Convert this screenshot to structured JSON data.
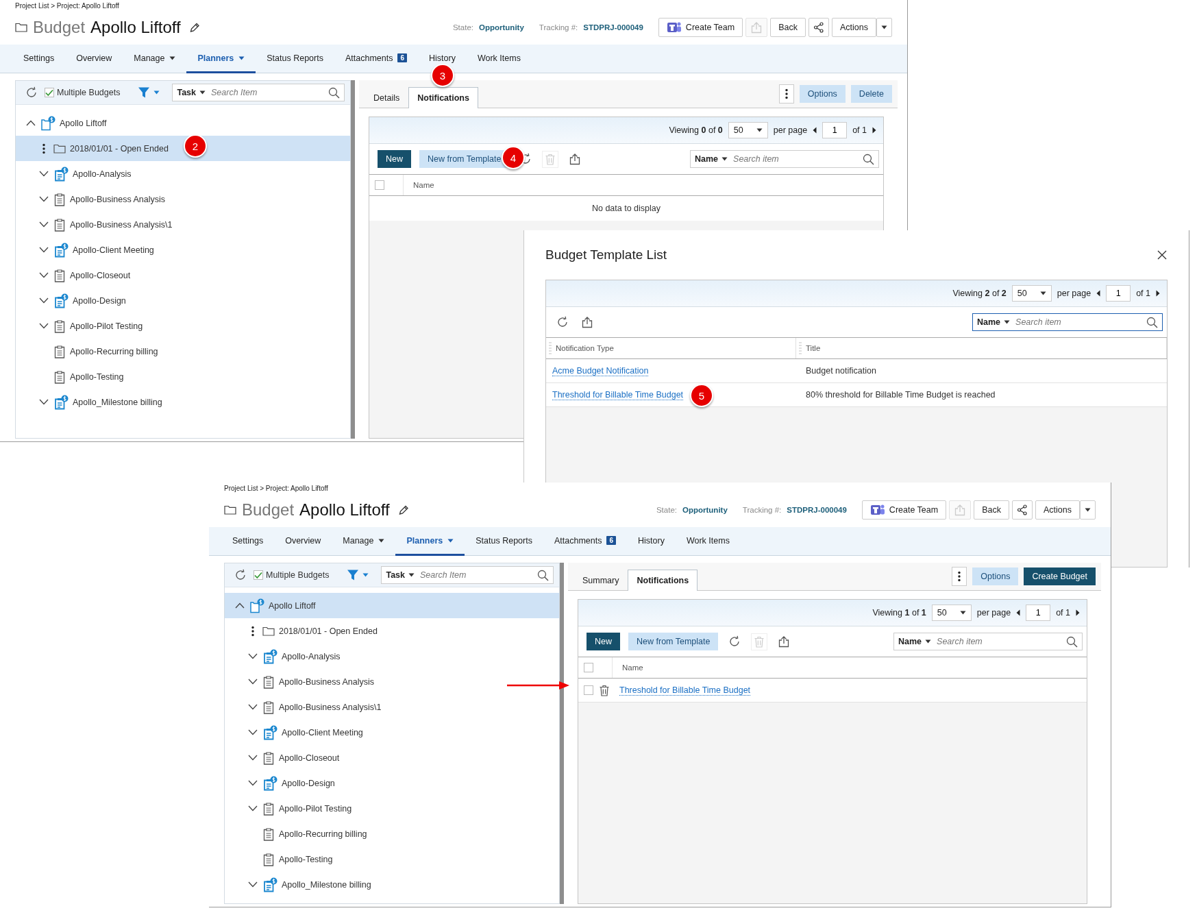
{
  "top_window": {
    "breadcrumb": "Project List > Project: Apollo Liftoff",
    "type_label": "Budget",
    "title": "Apollo Liftoff",
    "state_label": "State:",
    "state": "Opportunity",
    "tracking_label": "Tracking #:",
    "tracking": "STDPRJ-000049",
    "header_buttons": [
      {
        "kind": "teams",
        "label": "Create Team",
        "disabled": false
      },
      {
        "kind": "export",
        "disabled": true
      },
      {
        "kind": "text",
        "label": "Back",
        "disabled": false
      },
      {
        "kind": "share",
        "disabled": false
      },
      {
        "kind": "split",
        "label": "Actions",
        "disabled": false
      }
    ],
    "nav": [
      {
        "label": "Settings",
        "selected": false,
        "dropdown": false
      },
      {
        "label": "Overview",
        "selected": false,
        "dropdown": false
      },
      {
        "label": "Manage",
        "selected": false,
        "dropdown": true
      },
      {
        "label": "Planners",
        "selected": true,
        "dropdown": true
      },
      {
        "label": "Status Reports",
        "selected": false,
        "dropdown": false
      },
      {
        "label": "Attachments",
        "selected": false,
        "dropdown": false,
        "badge": "6"
      },
      {
        "label": "History",
        "selected": false,
        "dropdown": false
      },
      {
        "label": "Work Items",
        "selected": false,
        "dropdown": false
      }
    ],
    "tree_toolbar": {
      "multiple_budgets": {
        "label": "Multiple Budgets",
        "checked": true
      },
      "search": {
        "scope": "Task",
        "placeholder": "Search Item"
      }
    },
    "tree": [
      {
        "label": "Apollo Liftoff",
        "kind": "project",
        "expandable": true,
        "expanded": true,
        "menu": false,
        "selected": false,
        "children": [
          {
            "label": "2018/01/01 - Open Ended",
            "kind": "folder",
            "expandable": false,
            "menu": true,
            "selected": true
          },
          {
            "label": "Apollo-Analysis",
            "kind": "budget",
            "expandable": true,
            "expanded": false,
            "menu": false,
            "selected": false
          },
          {
            "label": "Apollo-Business Analysis",
            "kind": "task",
            "expandable": true,
            "expanded": false,
            "menu": false,
            "selected": false
          },
          {
            "label": "Apollo-Business Analysis\\1",
            "kind": "task",
            "expandable": true,
            "expanded": false,
            "menu": false,
            "selected": false
          },
          {
            "label": "Apollo-Client Meeting",
            "kind": "budget",
            "expandable": true,
            "expanded": false,
            "menu": false,
            "selected": false
          },
          {
            "label": "Apollo-Closeout",
            "kind": "task",
            "expandable": true,
            "expanded": false,
            "menu": false,
            "selected": false
          },
          {
            "label": "Apollo-Design",
            "kind": "budget",
            "expandable": true,
            "expanded": false,
            "menu": false,
            "selected": false
          },
          {
            "label": "Apollo-Pilot Testing",
            "kind": "task",
            "expandable": true,
            "expanded": false,
            "menu": false,
            "selected": false
          },
          {
            "label": "Apollo-Recurring billing",
            "kind": "task",
            "expandable": false,
            "menu": false,
            "selected": false
          },
          {
            "label": "Apollo-Testing",
            "kind": "task",
            "expandable": false,
            "menu": false,
            "selected": false
          },
          {
            "label": "Apollo_Milestone billing",
            "kind": "budget",
            "expandable": true,
            "expanded": false,
            "menu": false,
            "selected": false
          }
        ]
      }
    ],
    "tabs": [
      {
        "label": "Details",
        "selected": false
      },
      {
        "label": "Notifications",
        "selected": true
      }
    ],
    "tab_actions": [
      {
        "kind": "menu"
      },
      {
        "kind": "light",
        "label": "Options"
      },
      {
        "kind": "light",
        "label": "Delete"
      }
    ],
    "grid": {
      "pager": {
        "viewing": "Viewing **0** of **0**",
        "page_size": "50",
        "per_page": "per page",
        "page": "1",
        "of": "of 1"
      },
      "toolbar": [
        {
          "kind": "new",
          "label": "New"
        },
        {
          "kind": "template",
          "label": "New from Template"
        },
        {
          "kind": "refresh"
        },
        {
          "kind": "delete",
          "disabled": true
        },
        {
          "kind": "export",
          "disabled": false
        }
      ],
      "search": {
        "scope": "Name",
        "placeholder": "Search item",
        "focused": false
      },
      "select_all": {
        "checked": false
      },
      "columns": [
        "Name"
      ],
      "empty_message": "No data to display"
    }
  },
  "template_dialog": {
    "title": "Budget Template List",
    "grid": {
      "pager": {
        "viewing": "Viewing **2** of **2**",
        "page_size": "50",
        "per_page": "per page",
        "page": "1",
        "of": "of 1"
      },
      "toolbar": [
        {
          "kind": "refresh"
        },
        {
          "kind": "export",
          "disabled": false
        }
      ],
      "search": {
        "scope": "Name",
        "placeholder": "Search item",
        "focused": true
      },
      "columns": [
        "Notification Type",
        "Title"
      ],
      "rows": [
        {
          "cells": [
            {
              "text": "Acme Budget Notification",
              "link": true
            },
            {
              "text": "Budget notification",
              "link": false
            }
          ]
        },
        {
          "cells": [
            {
              "text": "Threshold for Billable Time Budget",
              "link": true
            },
            {
              "text": "80% threshold for Billable Time Budget is reached",
              "link": false
            }
          ]
        }
      ]
    }
  },
  "bottom_window": {
    "breadcrumb": "Project List > Project: Apollo Liftoff",
    "type_label": "Budget",
    "title": "Apollo Liftoff",
    "state_label": "State:",
    "state": "Opportunity",
    "tracking_label": "Tracking #:",
    "tracking": "STDPRJ-000049",
    "header_buttons": [
      {
        "kind": "teams",
        "label": "Create Team",
        "disabled": false
      },
      {
        "kind": "export",
        "disabled": true
      },
      {
        "kind": "text",
        "label": "Back",
        "disabled": false
      },
      {
        "kind": "share",
        "disabled": false
      },
      {
        "kind": "split",
        "label": "Actions",
        "disabled": false
      }
    ],
    "nav": [
      {
        "label": "Settings",
        "selected": false,
        "dropdown": false
      },
      {
        "label": "Overview",
        "selected": false,
        "dropdown": false
      },
      {
        "label": "Manage",
        "selected": false,
        "dropdown": true
      },
      {
        "label": "Planners",
        "selected": true,
        "dropdown": true
      },
      {
        "label": "Status Reports",
        "selected": false,
        "dropdown": false
      },
      {
        "label": "Attachments",
        "selected": false,
        "dropdown": false,
        "badge": "6"
      },
      {
        "label": "History",
        "selected": false,
        "dropdown": false
      },
      {
        "label": "Work Items",
        "selected": false,
        "dropdown": false
      }
    ],
    "tree_toolbar": {
      "multiple_budgets": {
        "label": "Multiple Budgets",
        "checked": true
      },
      "search": {
        "scope": "Task",
        "placeholder": "Search Item"
      }
    },
    "tree": [
      {
        "label": "Apollo Liftoff",
        "kind": "project",
        "expandable": true,
        "expanded": true,
        "menu": false,
        "selected": true,
        "children": [
          {
            "label": "2018/01/01 - Open Ended",
            "kind": "folder",
            "expandable": false,
            "menu": true,
            "selected": false
          },
          {
            "label": "Apollo-Analysis",
            "kind": "budget",
            "expandable": true,
            "expanded": false,
            "menu": false,
            "selected": false
          },
          {
            "label": "Apollo-Business Analysis",
            "kind": "task",
            "expandable": true,
            "expanded": false,
            "menu": false,
            "selected": false
          },
          {
            "label": "Apollo-Business Analysis\\1",
            "kind": "task",
            "expandable": true,
            "expanded": false,
            "menu": false,
            "selected": false
          },
          {
            "label": "Apollo-Client Meeting",
            "kind": "budget",
            "expandable": true,
            "expanded": false,
            "menu": false,
            "selected": false
          },
          {
            "label": "Apollo-Closeout",
            "kind": "task",
            "expandable": true,
            "expanded": false,
            "menu": false,
            "selected": false
          },
          {
            "label": "Apollo-Design",
            "kind": "budget",
            "expandable": true,
            "expanded": false,
            "menu": false,
            "selected": false
          },
          {
            "label": "Apollo-Pilot Testing",
            "kind": "task",
            "expandable": true,
            "expanded": false,
            "menu": false,
            "selected": false
          },
          {
            "label": "Apollo-Recurring billing",
            "kind": "task",
            "expandable": false,
            "menu": false,
            "selected": false
          },
          {
            "label": "Apollo-Testing",
            "kind": "task",
            "expandable": false,
            "menu": false,
            "selected": false
          },
          {
            "label": "Apollo_Milestone billing",
            "kind": "budget",
            "expandable": true,
            "expanded": false,
            "menu": false,
            "selected": false
          }
        ]
      }
    ],
    "tabs": [
      {
        "label": "Summary",
        "selected": false
      },
      {
        "label": "Notifications",
        "selected": true
      }
    ],
    "tab_actions": [
      {
        "kind": "menu"
      },
      {
        "kind": "light",
        "label": "Options"
      },
      {
        "kind": "dark",
        "label": "Create Budget"
      }
    ],
    "grid": {
      "pager": {
        "viewing": "Viewing **1** of **1**",
        "page_size": "50",
        "per_page": "per page",
        "page": "1",
        "of": "of 1"
      },
      "toolbar": [
        {
          "kind": "new",
          "label": "New"
        },
        {
          "kind": "template",
          "label": "New from Template"
        },
        {
          "kind": "refresh"
        },
        {
          "kind": "delete",
          "disabled": true
        },
        {
          "kind": "export",
          "disabled": false
        }
      ],
      "search": {
        "scope": "Name",
        "placeholder": "Search item",
        "focused": false
      },
      "select_all": {
        "checked": false
      },
      "columns": [
        "Name"
      ],
      "rows": [
        {
          "checked": false,
          "cells": [
            {
              "text": "Threshold for Billable Time Budget",
              "link": true
            }
          ]
        }
      ]
    }
  },
  "callouts": [
    {
      "text": "2"
    },
    {
      "text": "3"
    },
    {
      "text": "4"
    },
    {
      "text": "5"
    }
  ]
}
